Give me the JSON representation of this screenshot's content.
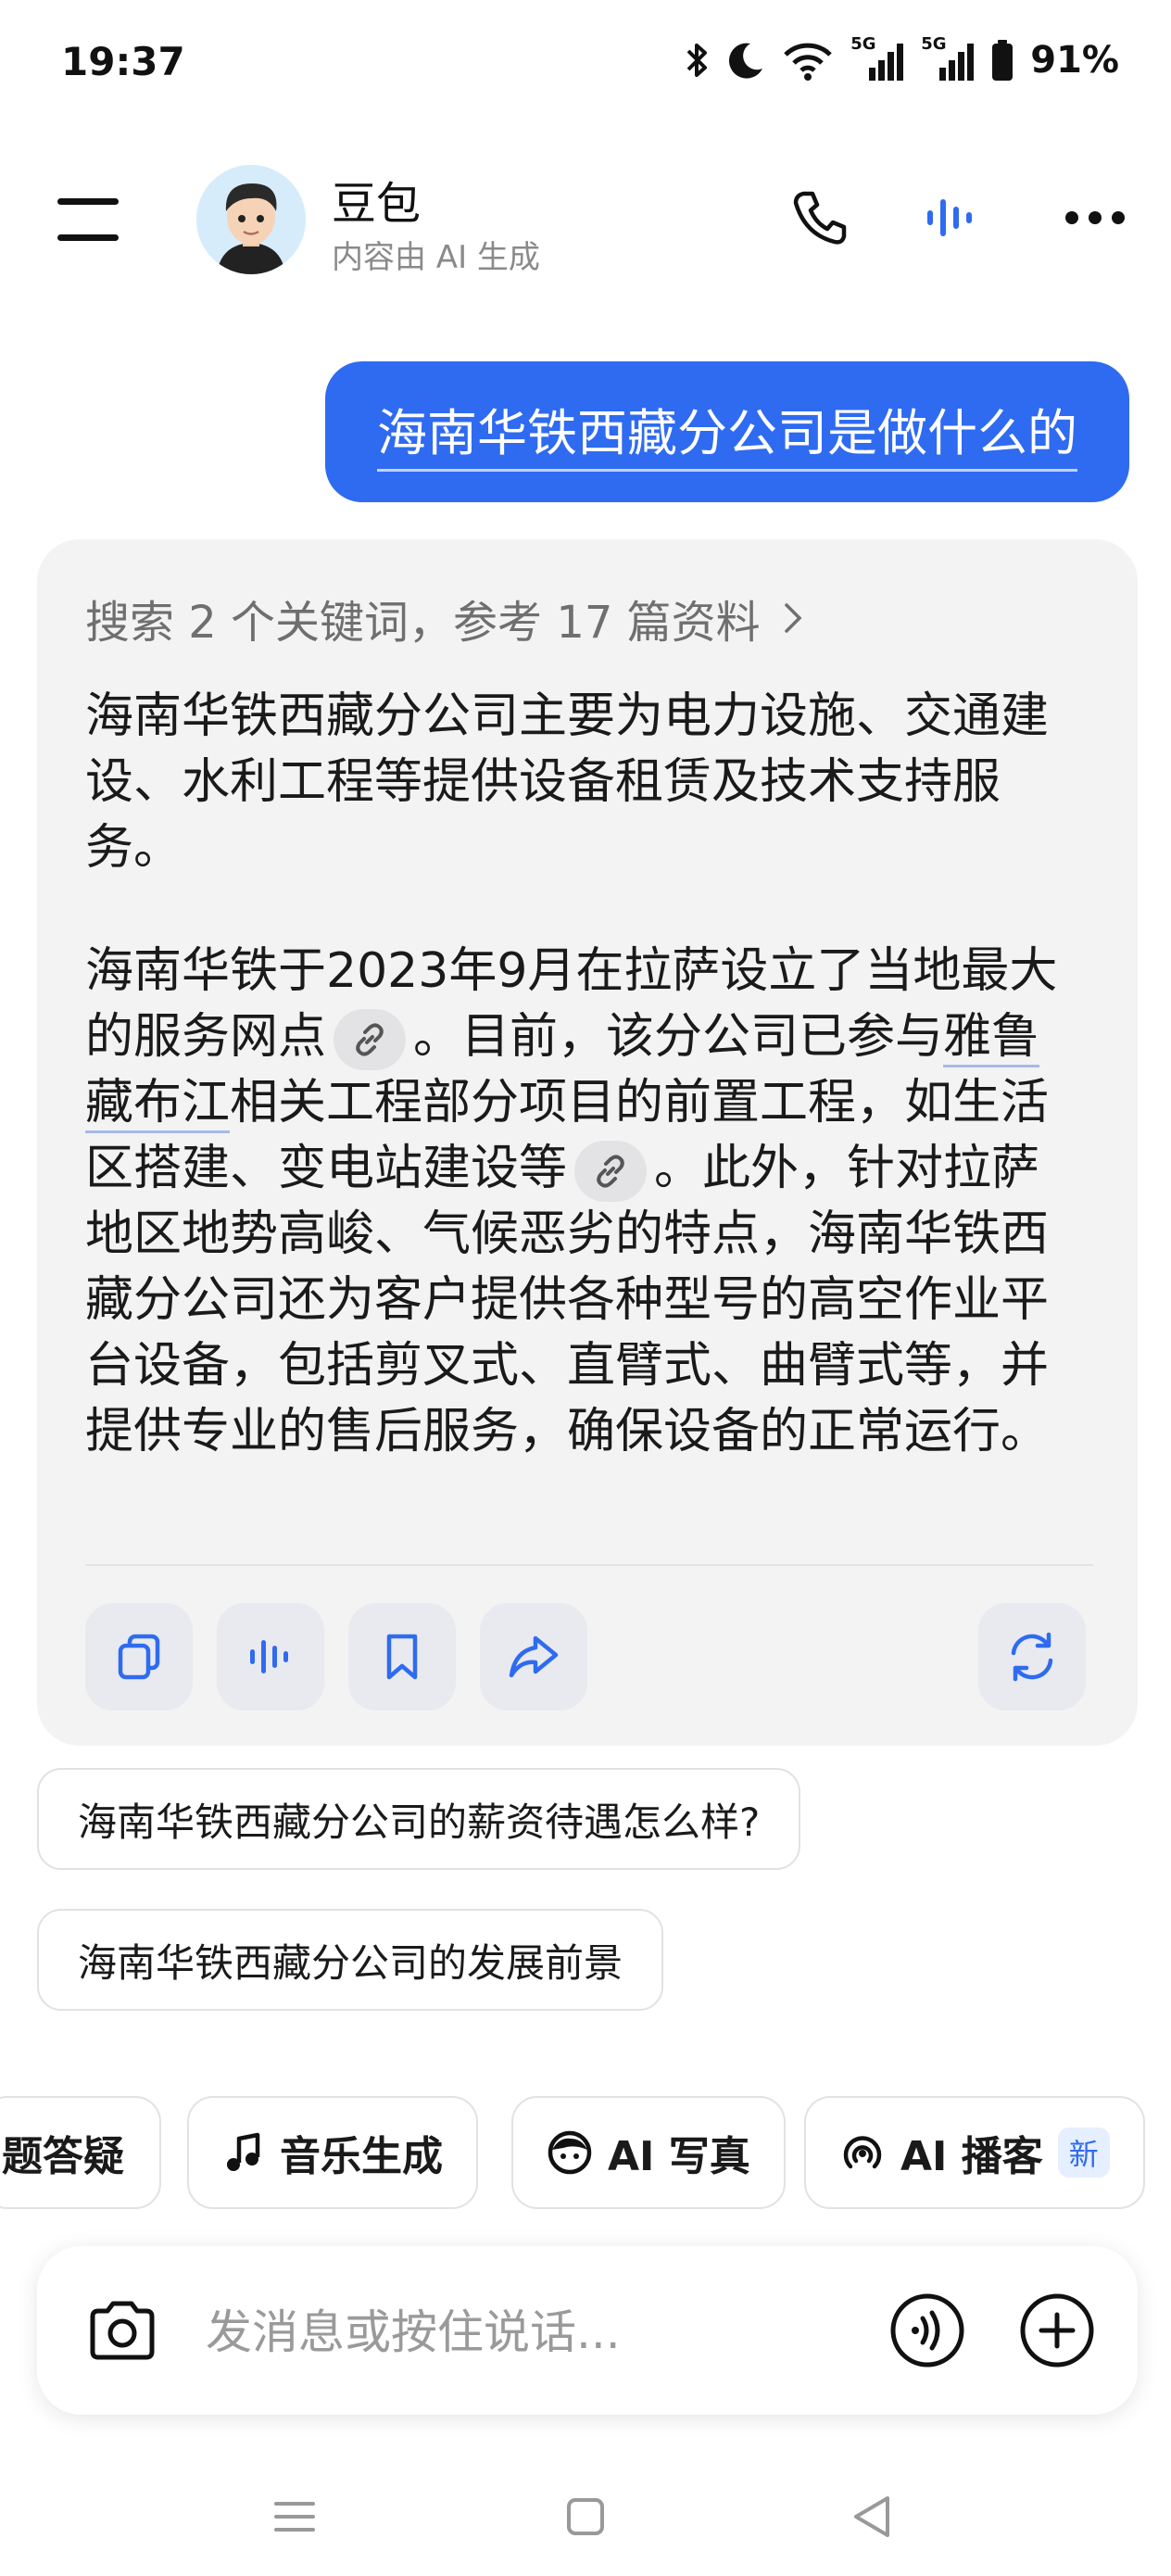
{
  "status_bar": {
    "time": "19:37",
    "network_1": "5G",
    "network_2": "5G",
    "battery": "91%"
  },
  "header": {
    "title": "豆包",
    "subtitle": "内容由 AI 生成"
  },
  "user_message": "海南华铁西藏分公司是做什么的",
  "ai_reply": {
    "search_summary": "搜索 2 个关键词，参考 17 篇资料",
    "p1": "海南华铁西藏分公司主要为电力设施、交通建设、水利工程等提供设备租赁及技术支持服务。",
    "p2_a": "海南华铁于2023年9月在拉萨设立了当地最大的服务网点",
    "p2_b": "。目前，该分公司已参与",
    "p2_link": "雅鲁藏布江",
    "p2_c": "相关工程部分项目的前置工程，如生活区搭建、变电站建设等",
    "p2_d": "。此外，针对拉萨地区地势高峻、气候恶劣的特点，海南华铁西藏分公司还为客户提供各种型号的高空作业平台设备，包括剪叉式、直臂式、曲臂式等，并提供专业的售后服务，确保设备的正常运行。"
  },
  "suggestions": [
    "海南华铁西藏分公司的薪资待遇怎么样?",
    "海南华铁西藏分公司的发展前景"
  ],
  "skills": {
    "partial": "题答疑",
    "music": "音乐生成",
    "photo": "AI 写真",
    "podcast": "AI 播客",
    "new_badge": "新"
  },
  "input": {
    "placeholder": "发消息或按住说话..."
  },
  "colors": {
    "accent": "#2f6bf0",
    "card_bg": "#f3f3f4"
  }
}
